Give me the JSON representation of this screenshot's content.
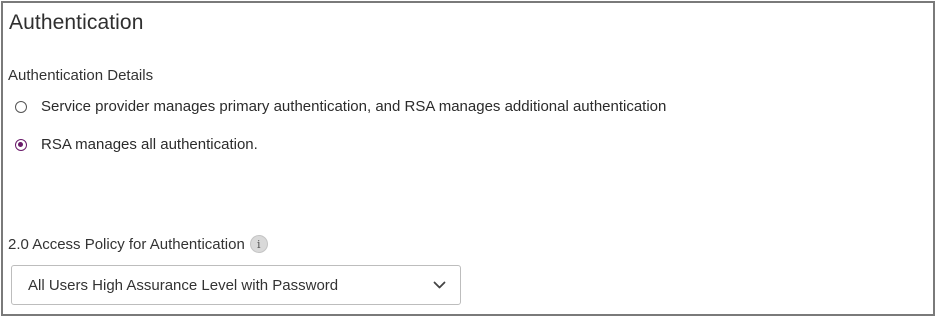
{
  "panel": {
    "title": "Authentication",
    "details_label": "Authentication Details",
    "options": [
      {
        "label": "Service provider manages primary authentication, and RSA manages additional authentication",
        "selected": false
      },
      {
        "label": "RSA manages all authentication.",
        "selected": true
      }
    ],
    "policy": {
      "label": "2.0 Access Policy for Authentication",
      "info_icon": "info-icon",
      "selected_value": "All Users High Assurance Level with Password",
      "dropdown_icon": "chevron-down-icon"
    }
  },
  "colors": {
    "border": "#7a7a7a",
    "radio_selected": "#6a1b6a",
    "text": "#2b2b2b"
  }
}
